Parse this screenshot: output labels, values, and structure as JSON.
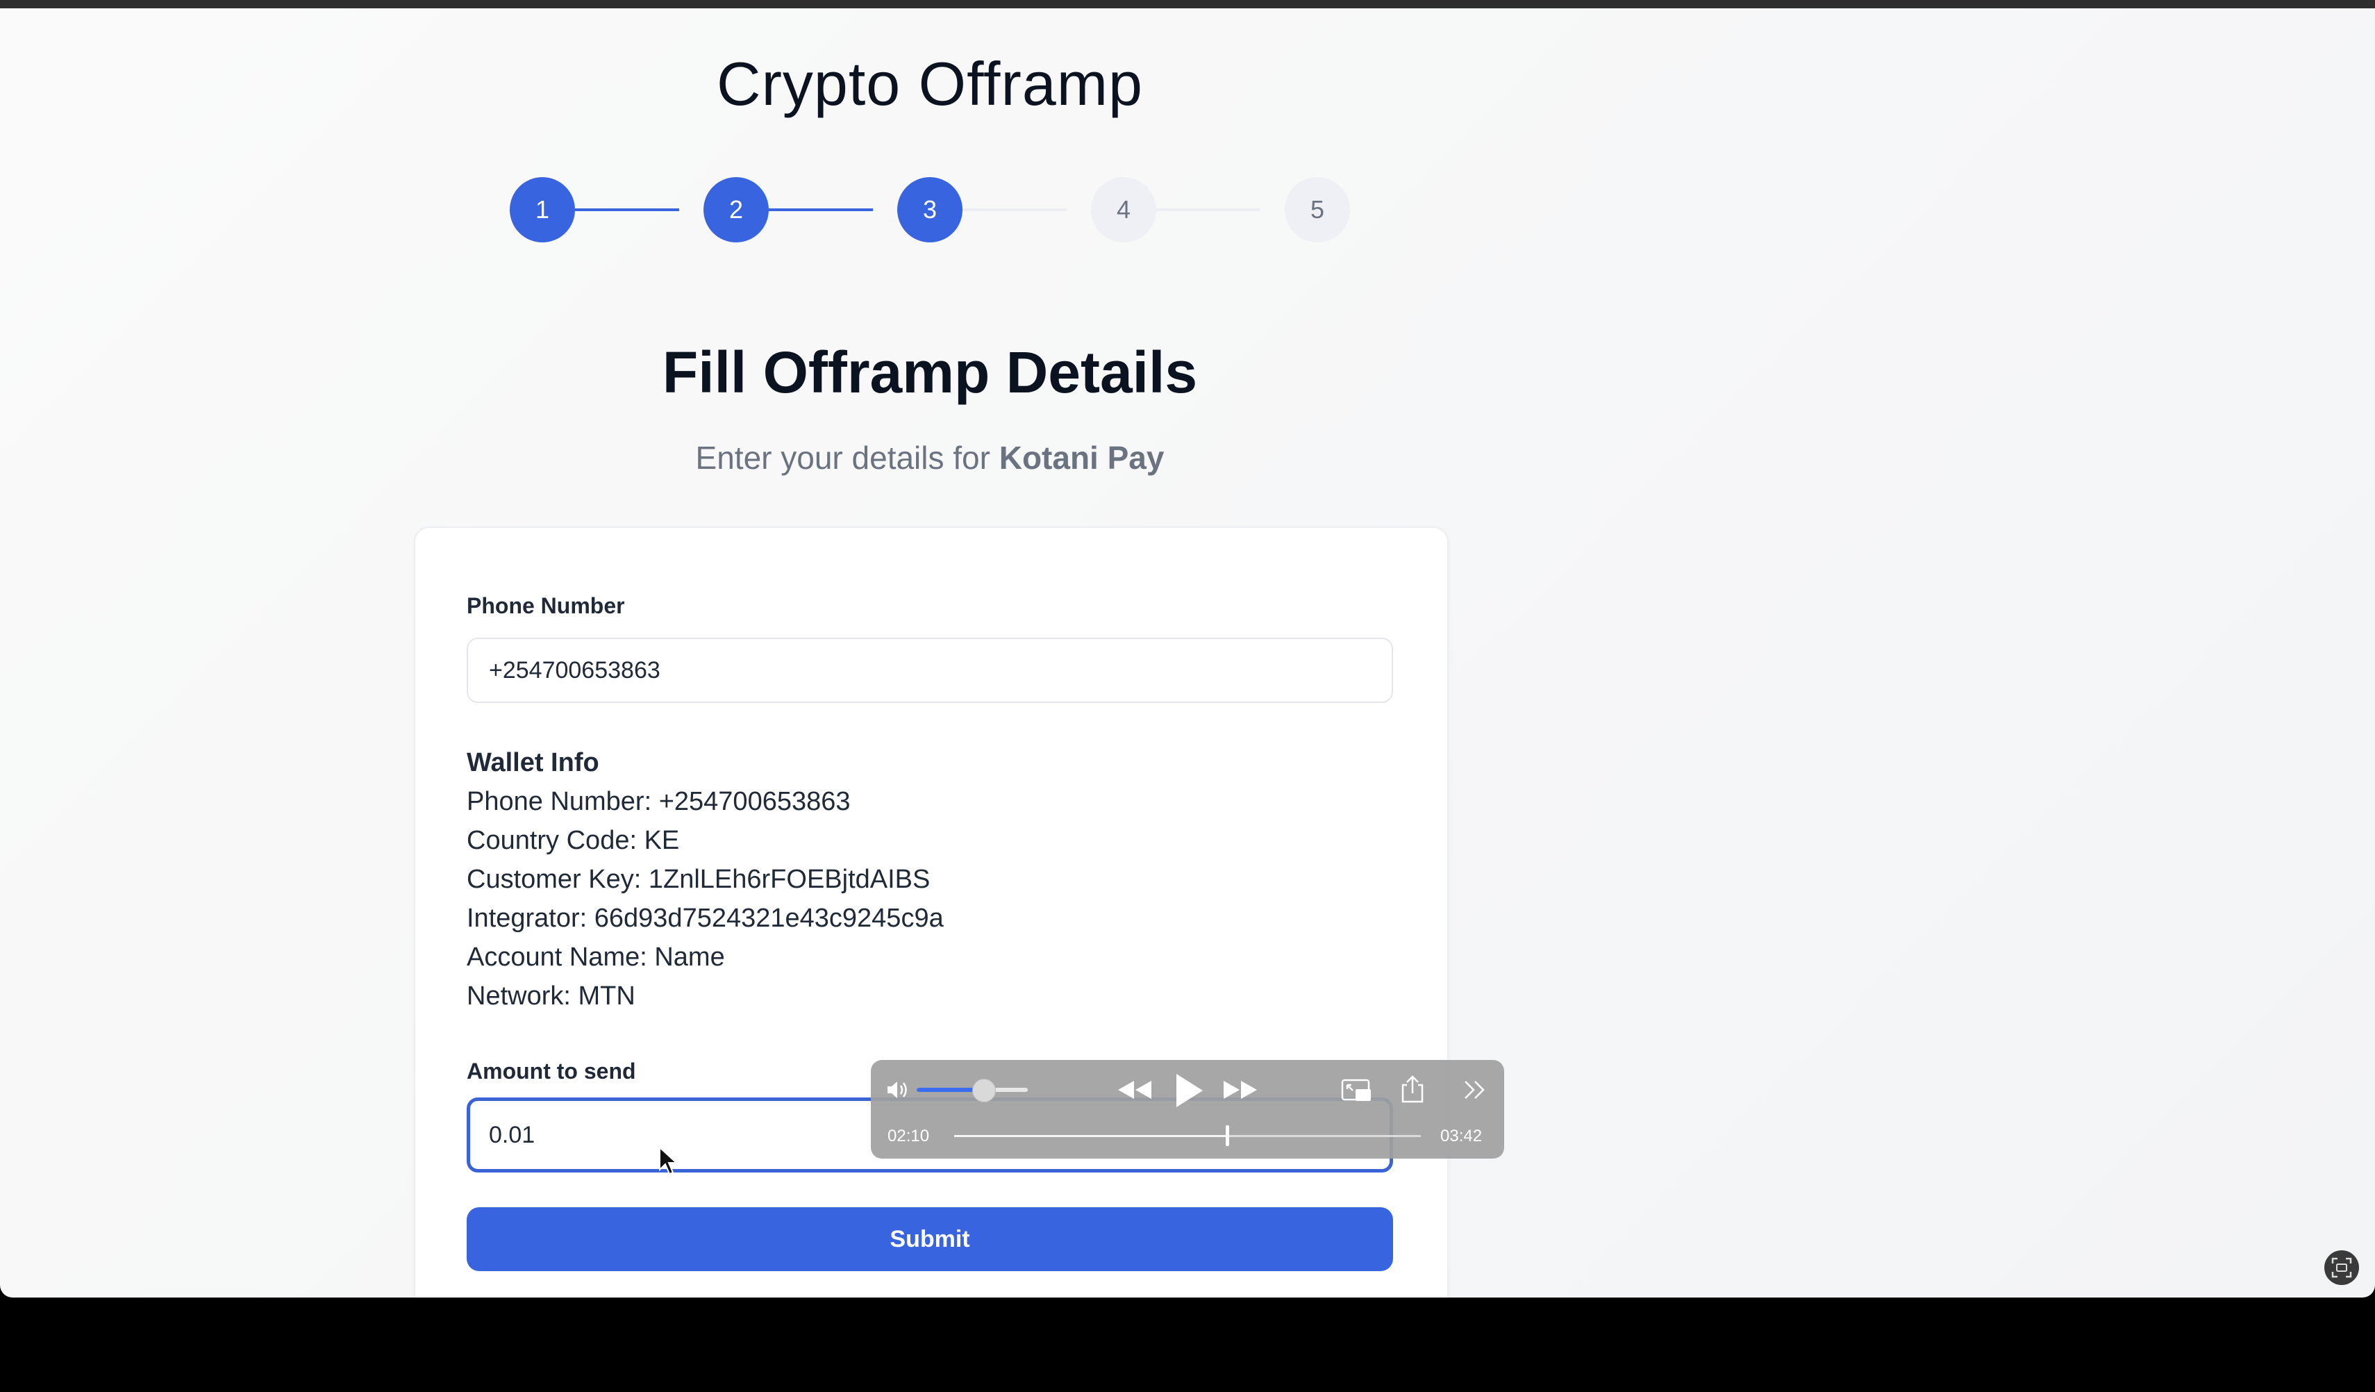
{
  "app": {
    "title": "Crypto Offramp"
  },
  "stepper": {
    "current_step": 3,
    "steps": [
      {
        "label": "1",
        "state": "done"
      },
      {
        "label": "2",
        "state": "done"
      },
      {
        "label": "3",
        "state": "done"
      },
      {
        "label": "4",
        "state": "todo"
      },
      {
        "label": "5",
        "state": "todo"
      }
    ]
  },
  "form": {
    "heading": "Fill Offramp Details",
    "subheading_prefix": "Enter your details for",
    "provider": "Kotani Pay",
    "phone_label": "Phone Number",
    "phone_value": "+254700653863",
    "amount_label": "Amount to send",
    "amount_value": "0.01",
    "submit_label": "Submit"
  },
  "wallet": {
    "title": "Wallet Info",
    "lines": [
      "Phone Number: +254700653863",
      "Country Code: KE",
      "Customer Key: 1ZnlLEh6rFOEBjtdAIBS",
      "Integrator: 66d93d7524321e43c9245c9a",
      "Account Name: Name",
      "Network: MTN"
    ]
  },
  "player": {
    "current_time": "02:10",
    "duration": "03:42",
    "progress_fraction": 0.585,
    "volume_fraction": 0.6,
    "state": "paused",
    "icons": {
      "volume": "speaker-icon",
      "rewind": "rewind-icon",
      "play": "play-icon",
      "forward": "fast-forward-icon",
      "pip": "picture-in-picture-icon",
      "share": "share-icon",
      "more": "double-chevron-right-icon"
    }
  },
  "colors": {
    "accent": "#3964e0",
    "step_inactive": "#eef0f6",
    "focus_border": "#3a63d8"
  }
}
